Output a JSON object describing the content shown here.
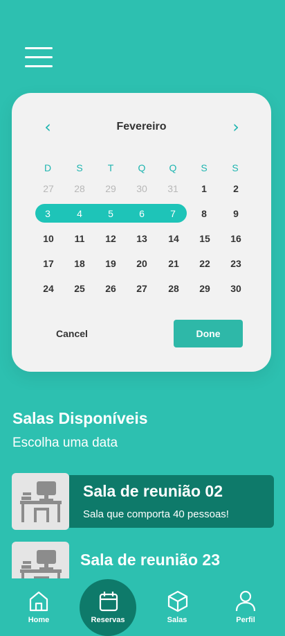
{
  "calendar": {
    "month": "Fevereiro",
    "prev_icon": "chevron-left-icon",
    "next_icon": "chevron-right-icon",
    "weekdays": [
      "D",
      "S",
      "T",
      "Q",
      "Q",
      "S",
      "S"
    ],
    "weeks": [
      [
        "27",
        "28",
        "29",
        "30",
        "31",
        "1",
        "2"
      ],
      [
        "3",
        "4",
        "5",
        "6",
        "7",
        "8",
        "9"
      ],
      [
        "10",
        "11",
        "12",
        "13",
        "14",
        "15",
        "16"
      ],
      [
        "17",
        "18",
        "19",
        "20",
        "21",
        "22",
        "23"
      ],
      [
        "24",
        "25",
        "26",
        "27",
        "28",
        "29",
        "30"
      ]
    ],
    "selected": [
      "3",
      "4",
      "5",
      "6",
      "7"
    ],
    "cancel_label": "Cancel",
    "done_label": "Done"
  },
  "section": {
    "title": "Salas Disponíveis",
    "subtitle": "Escolha uma data"
  },
  "rooms": [
    {
      "name": "Sala de reunião 02",
      "desc": "Sala que comporta 40 pessoas!"
    },
    {
      "name": "Sala de reunião 23",
      "desc": ""
    }
  ],
  "nav": {
    "items": [
      {
        "label": "Home",
        "icon": "home-icon"
      },
      {
        "label": "Reservas",
        "icon": "calendar-icon"
      },
      {
        "label": "Salas",
        "icon": "cube-icon"
      },
      {
        "label": "Perfil",
        "icon": "user-icon"
      }
    ],
    "active": "Reservas"
  },
  "colors": {
    "background": "#2dc0b0",
    "accent": "#1ec4b8",
    "dark_accent": "#0e7a6a",
    "card": "#f2f2f2"
  }
}
